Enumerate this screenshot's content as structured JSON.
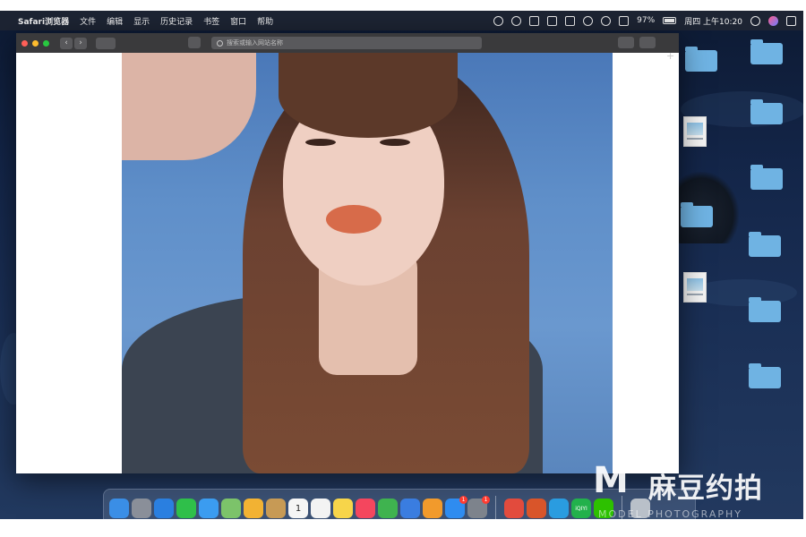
{
  "menubar": {
    "apple_glyph": "",
    "app_name": "Safari浏览器",
    "menus": [
      "文件",
      "编辑",
      "显示",
      "历史记录",
      "书签",
      "窗口",
      "帮助"
    ],
    "battery": "97%",
    "datetime": "周四 上午10:20"
  },
  "safari": {
    "address_placeholder": "搜索或输入网站名称",
    "back_glyph": "‹",
    "forward_glyph": "›",
    "new_tab_glyph": "+"
  },
  "desktop": {
    "folders": [
      "folder",
      "folder",
      "folder",
      "folder",
      "folder",
      "folder",
      "folder",
      "folder",
      "folder",
      "folder",
      "folder"
    ],
    "files": [
      "image-file",
      "image-file"
    ]
  },
  "dock": {
    "apps": [
      {
        "name": "finder",
        "color": "#3a8ee6"
      },
      {
        "name": "launchpad",
        "color": "#8a8f99"
      },
      {
        "name": "safari",
        "color": "#2a7fe0"
      },
      {
        "name": "facetime",
        "color": "#2fbf4a"
      },
      {
        "name": "messages",
        "color": "#3b9cf0"
      },
      {
        "name": "maps",
        "color": "#7cc36a"
      },
      {
        "name": "photos",
        "color": "#f2b233"
      },
      {
        "name": "notebook",
        "color": "#c79a55"
      },
      {
        "name": "calendar",
        "color": "#f5f5f5",
        "label": "1"
      },
      {
        "name": "reminders",
        "color": "#f3f3f3"
      },
      {
        "name": "notes",
        "color": "#f7d54a"
      },
      {
        "name": "music",
        "color": "#f4465e"
      },
      {
        "name": "numbers",
        "color": "#3fb34f"
      },
      {
        "name": "keynote",
        "color": "#3a7de0"
      },
      {
        "name": "pages",
        "color": "#f19a2c"
      },
      {
        "name": "app-store",
        "color": "#2f8cf0",
        "badge": "1"
      },
      {
        "name": "system-preferences",
        "color": "#7d838c",
        "badge": "1"
      }
    ],
    "apps_right": [
      {
        "name": "chrome",
        "color": "#e24b3d"
      },
      {
        "name": "office",
        "color": "#d9552a"
      },
      {
        "name": "browser",
        "color": "#2a9ce0"
      },
      {
        "name": "iqiyi",
        "color": "#22b14c",
        "label": "iQIYI"
      },
      {
        "name": "wechat",
        "color": "#2dc100"
      }
    ],
    "trash": {
      "name": "trash",
      "color": "#b9c0c9"
    }
  },
  "watermark": {
    "logo": "M",
    "chinese": "麻豆约拍",
    "english": "MODEL PHOTOGRAPHY"
  }
}
